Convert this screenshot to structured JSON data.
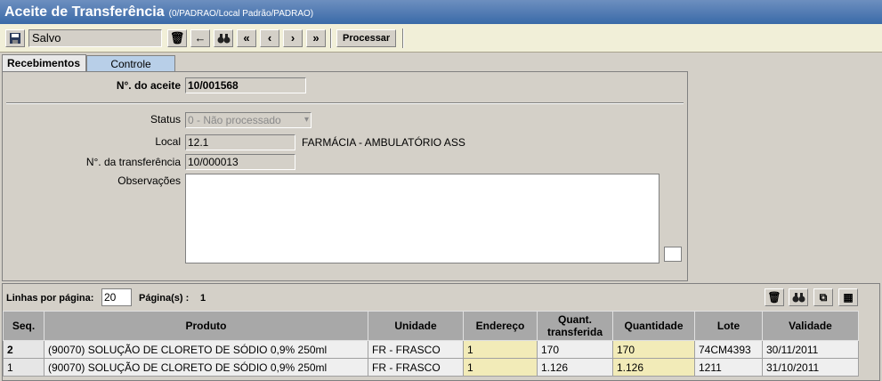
{
  "window": {
    "title": "Aceite de Transferência",
    "path": "(0/PADRAO/Local Padrão/PADRAO)"
  },
  "toolbar": {
    "status": "Salvo",
    "process_label": "Processar"
  },
  "tabs": [
    {
      "label": "Recebimentos"
    },
    {
      "label": "Controle"
    }
  ],
  "form": {
    "aceite_label": "N°. do aceite",
    "aceite_value": "10/001568",
    "status_label": "Status",
    "status_value": "0 - Não processado",
    "local_label": "Local",
    "local_code": "12.1",
    "local_name": "FARMÁCIA - AMBULATÓRIO ASS",
    "transf_label": "N°. da transferência",
    "transf_value": "10/000013",
    "obs_label": "Observações",
    "obs_value": ""
  },
  "grid": {
    "lines_label": "Linhas por página:",
    "lines_value": "20",
    "pages_label": "Página(s) :",
    "pages_value": "1",
    "columns": [
      "Seq.",
      "Produto",
      "Unidade",
      "Endereço",
      "Quant. transferida",
      "Quantidade",
      "Lote",
      "Validade"
    ],
    "rows": [
      [
        "2",
        "(90070) SOLUÇÃO DE CLORETO DE SÓDIO 0,9% 250ml",
        "FR - FRASCO",
        "1",
        "170",
        "170",
        "74CM4393",
        "30/11/2011"
      ],
      [
        "1",
        "(90070) SOLUÇÃO DE CLORETO DE SÓDIO 0,9% 250ml",
        "FR - FRASCO",
        "1",
        "1.126",
        "1.126",
        "1211",
        "31/10/2011"
      ]
    ]
  }
}
